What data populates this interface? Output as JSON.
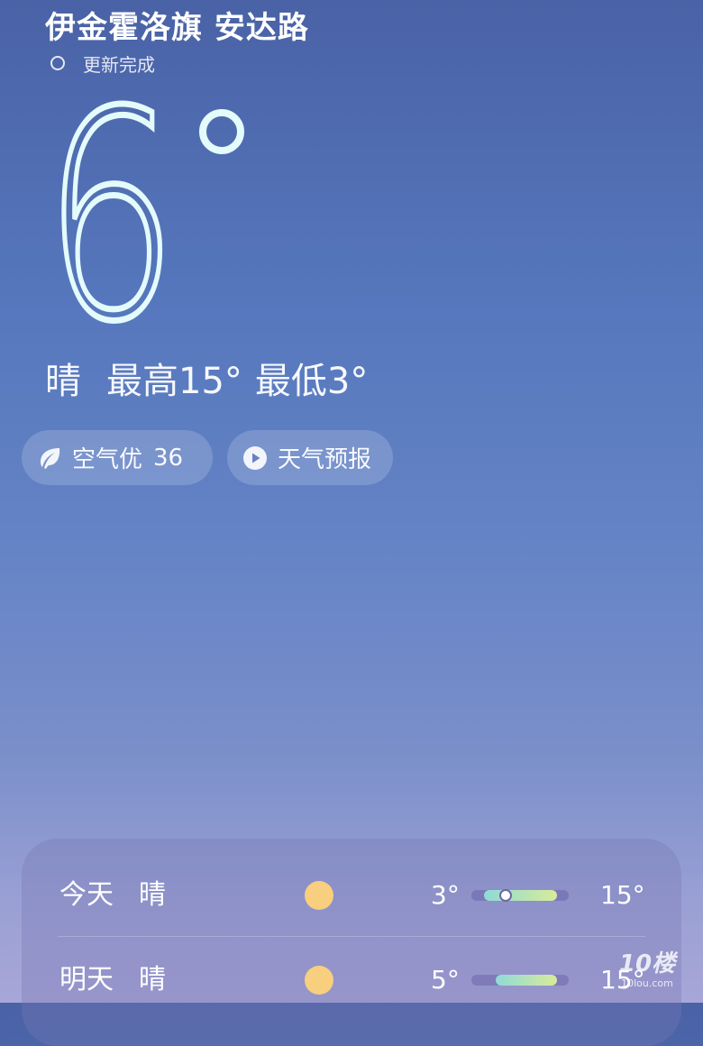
{
  "location": "伊金霍洛旗 安达路",
  "update_status": "更新完成",
  "current": {
    "temperature": "6",
    "condition": "晴",
    "high": "最高15°",
    "low": "最低3°"
  },
  "chips": {
    "aqi_label": "空气优",
    "aqi_value": "36",
    "forecast_label": "天气预报"
  },
  "daily": [
    {
      "day": "今天",
      "condition": "晴",
      "icon": "sun-icon",
      "low": "3°",
      "high": "15°",
      "range_start": 0.13,
      "range_end": 0.88,
      "current_marker": 0.35
    },
    {
      "day": "明天",
      "condition": "晴",
      "icon": "sun-icon",
      "low": "5°",
      "high": "15°",
      "range_start": 0.25,
      "range_end": 0.88
    }
  ],
  "watermark": {
    "main": "10楼",
    "sub": "10lou.com"
  },
  "colors": {
    "background_top": "#4a62a6",
    "background_bottom": "#a8a6d8",
    "temp_digit": "#e4fbfb",
    "sun": "#f8cf7e",
    "range_low": "#8fdad8",
    "range_high": "#d8eb9a"
  }
}
